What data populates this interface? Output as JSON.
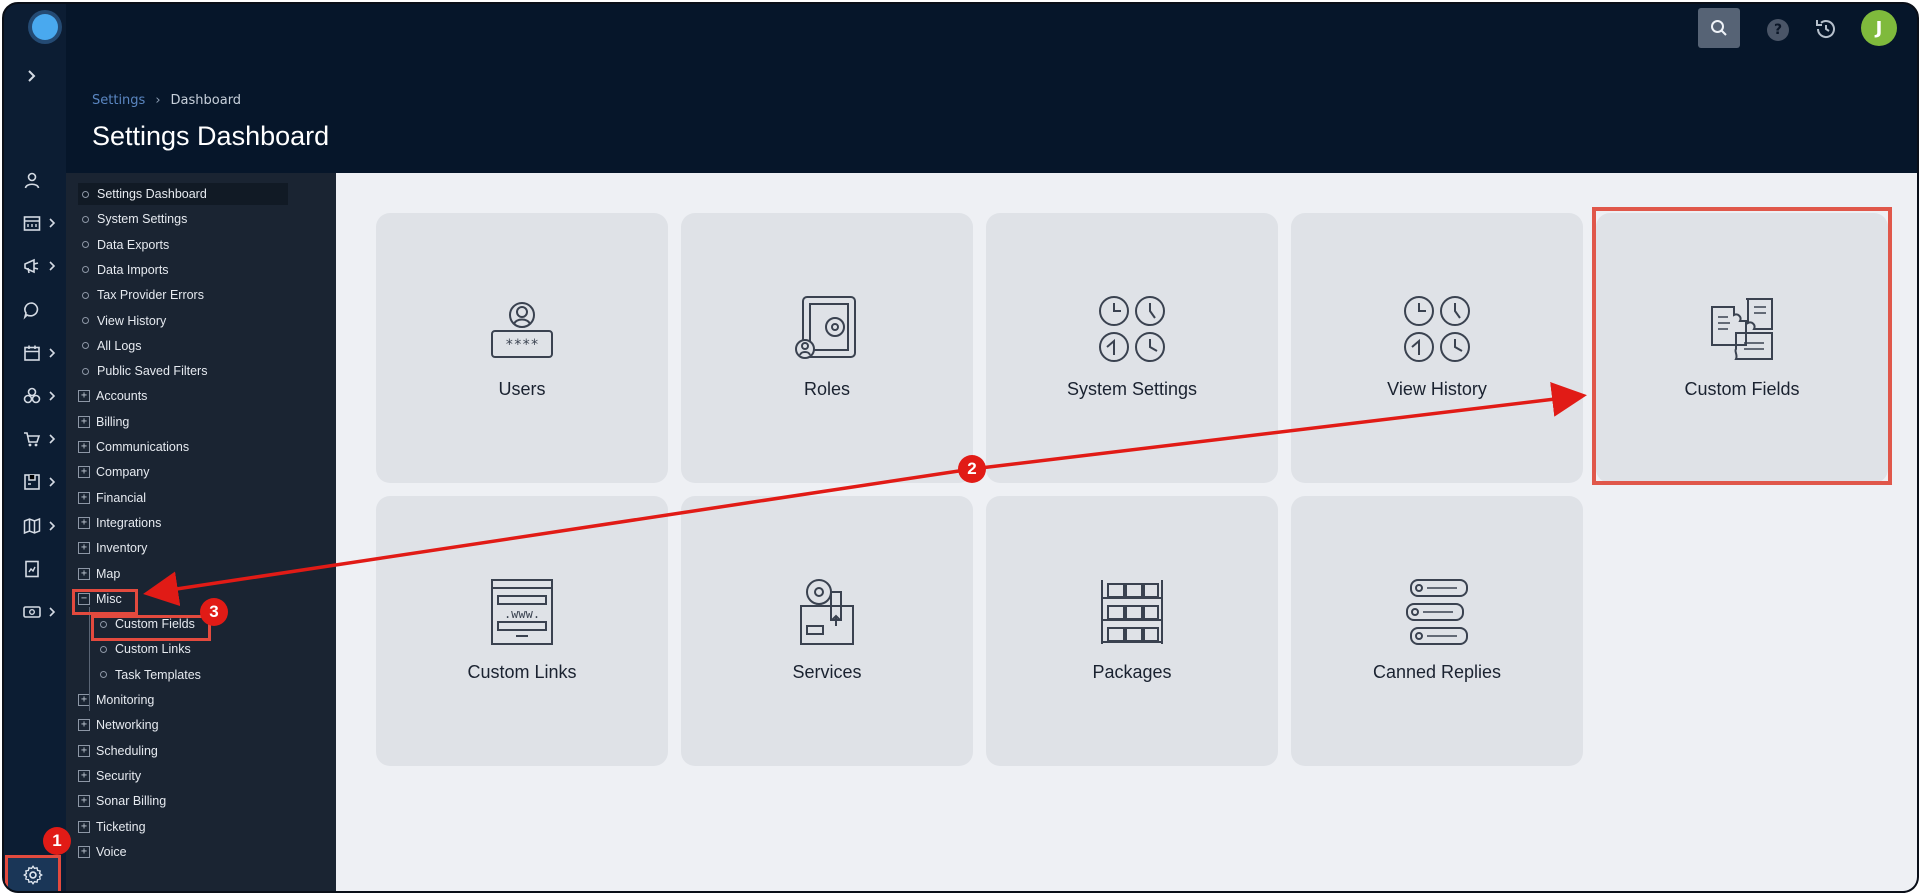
{
  "app": {
    "logo": "brand-logo"
  },
  "topbar": {
    "search_icon": "search-icon",
    "help_label": "?",
    "history_icon": "history-icon",
    "avatar_initial": "J"
  },
  "header": {
    "breadcrumb": [
      "Settings",
      "›",
      "Dashboard"
    ],
    "title": "Settings Dashboard"
  },
  "rail": {
    "expand_icon": "chevron-right-icon",
    "items": [
      {
        "icon": "user-icon",
        "has_chevron": false
      },
      {
        "icon": "billing-icon",
        "has_chevron": true
      },
      {
        "icon": "megaphone-icon",
        "has_chevron": true
      },
      {
        "icon": "chat-icon",
        "has_chevron": false
      },
      {
        "icon": "calendar-icon",
        "has_chevron": true
      },
      {
        "icon": "network-icon",
        "has_chevron": true
      },
      {
        "icon": "cart-icon",
        "has_chevron": true
      },
      {
        "icon": "inventory-icon",
        "has_chevron": true
      },
      {
        "icon": "map-icon",
        "has_chevron": true
      },
      {
        "icon": "report-icon",
        "has_chevron": false
      },
      {
        "icon": "money-icon",
        "has_chevron": true
      }
    ],
    "settings_icon": "gear-icon"
  },
  "nav": {
    "items": [
      {
        "label": "Settings Dashboard",
        "kind": "leaf"
      },
      {
        "label": "System Settings",
        "kind": "leaf"
      },
      {
        "label": "Data Exports",
        "kind": "leaf"
      },
      {
        "label": "Data Imports",
        "kind": "leaf"
      },
      {
        "label": "Tax Provider Errors",
        "kind": "leaf"
      },
      {
        "label": "View History",
        "kind": "leaf"
      },
      {
        "label": "All Logs",
        "kind": "leaf"
      },
      {
        "label": "Public Saved Filters",
        "kind": "leaf"
      },
      {
        "label": "Accounts",
        "kind": "group"
      },
      {
        "label": "Billing",
        "kind": "group"
      },
      {
        "label": "Communications",
        "kind": "group"
      },
      {
        "label": "Company",
        "kind": "group"
      },
      {
        "label": "Financial",
        "kind": "group"
      },
      {
        "label": "Integrations",
        "kind": "group"
      },
      {
        "label": "Inventory",
        "kind": "group"
      },
      {
        "label": "Map",
        "kind": "group"
      },
      {
        "label": "Misc",
        "kind": "group-open"
      },
      {
        "label": "Custom Fields",
        "kind": "sub"
      },
      {
        "label": "Custom Links",
        "kind": "sub"
      },
      {
        "label": "Task Templates",
        "kind": "sub"
      },
      {
        "label": "Monitoring",
        "kind": "group"
      },
      {
        "label": "Networking",
        "kind": "group"
      },
      {
        "label": "Scheduling",
        "kind": "group"
      },
      {
        "label": "Security",
        "kind": "group"
      },
      {
        "label": "Sonar Billing",
        "kind": "group"
      },
      {
        "label": "Ticketing",
        "kind": "group"
      },
      {
        "label": "Voice",
        "kind": "group"
      }
    ]
  },
  "cards": [
    {
      "label": "Users",
      "icon": "users-icon"
    },
    {
      "label": "Roles",
      "icon": "roles-icon"
    },
    {
      "label": "System Settings",
      "icon": "clocks-icon"
    },
    {
      "label": "View History",
      "icon": "clocks-icon"
    },
    {
      "label": "Custom Fields",
      "icon": "puzzle-icon"
    },
    {
      "label": "Custom Links",
      "icon": "www-icon"
    },
    {
      "label": "Services",
      "icon": "tape-box-icon"
    },
    {
      "label": "Packages",
      "icon": "shelves-icon"
    },
    {
      "label": "Canned Replies",
      "icon": "chat-bubbles-icon"
    }
  ],
  "annotations": {
    "step1": "1",
    "step2": "2",
    "step3": "3",
    "color": "#e11b16"
  },
  "colors": {
    "background": "#06162a",
    "nav": "#1a2432",
    "main": "#eef0f4",
    "card": "#dfe2e7",
    "highlight": "#e34a3e"
  }
}
